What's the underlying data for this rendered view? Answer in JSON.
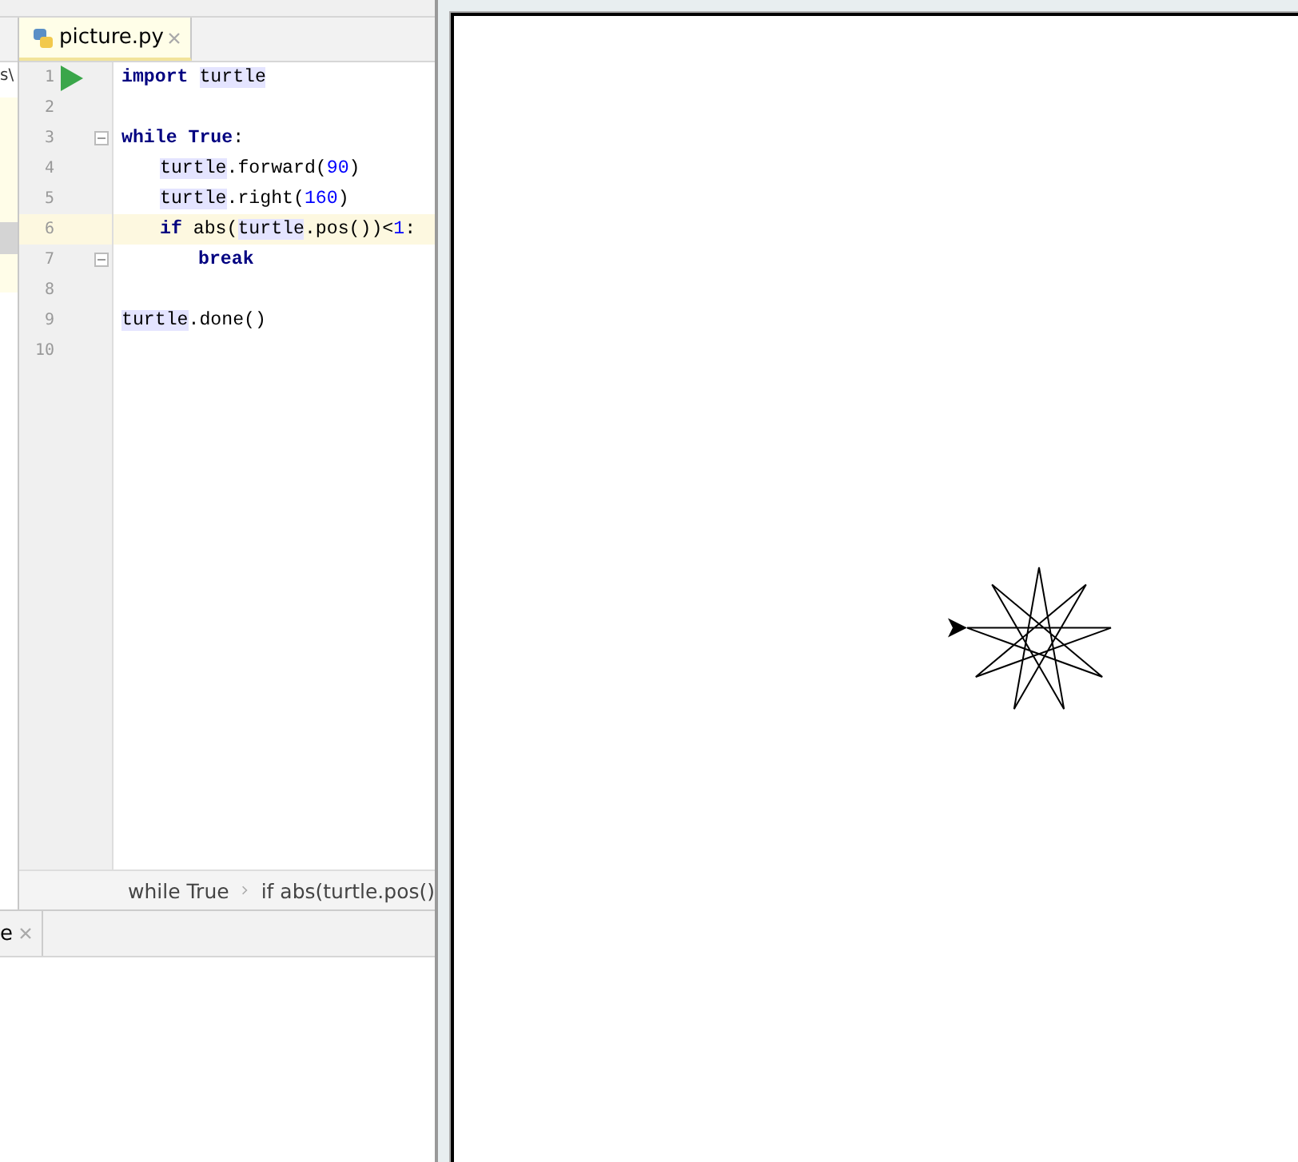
{
  "left_strip": {
    "path_fragment": "s\\"
  },
  "editor_tab": {
    "title": "picture.py",
    "selected": true
  },
  "code_lines": [
    {
      "number": "1",
      "run": true,
      "current": false,
      "fold": false,
      "tokens": [
        {
          "kind": "keyword",
          "text": "import"
        },
        {
          "kind": "module",
          "text": "turtle"
        }
      ]
    },
    {
      "number": "2",
      "run": false,
      "current": false,
      "fold": false
    },
    {
      "number": "3",
      "run": false,
      "current": false,
      "fold": true,
      "tokens": [
        {
          "kind": "keyword",
          "text": "while"
        },
        {
          "kind": "keyword",
          "text": "True"
        },
        {
          "kind": "plain",
          "text": ":"
        }
      ],
      "children": [
        {
          "number": "4",
          "run": false,
          "current": false,
          "fold": false,
          "tokens": [
            {
              "kind": "module",
              "text": "turtle"
            },
            {
              "kind": "plain",
              "text": ".forward("
            },
            {
              "kind": "number",
              "text": "90"
            },
            {
              "kind": "plain",
              "text": ")"
            }
          ]
        },
        {
          "number": "5",
          "run": false,
          "current": false,
          "fold": false,
          "tokens": [
            {
              "kind": "module",
              "text": "turtle"
            },
            {
              "kind": "plain",
              "text": ".right("
            },
            {
              "kind": "number",
              "text": "160"
            },
            {
              "kind": "plain",
              "text": ")"
            }
          ]
        },
        {
          "number": "6",
          "run": false,
          "current": true,
          "fold": false,
          "tokens": [
            {
              "kind": "keyword",
              "text": "if"
            },
            {
              "kind": "plain",
              "text": " abs("
            },
            {
              "kind": "module",
              "text": "turtle"
            },
            {
              "kind": "plain",
              "text": ".pos())<"
            },
            {
              "kind": "number",
              "text": "1"
            },
            {
              "kind": "plain",
              "text": ":"
            }
          ],
          "children": [
            {
              "number": "7",
              "run": false,
              "current": false,
              "fold": true,
              "tokens": [
                {
                  "kind": "keyword",
                  "text": "break"
                }
              ]
            }
          ]
        }
      ]
    },
    {
      "number": "8",
      "run": false,
      "current": false,
      "fold": false
    },
    {
      "number": "9",
      "run": false,
      "current": false,
      "fold": false,
      "tokens": [
        {
          "kind": "module",
          "text": "turtle"
        },
        {
          "kind": "plain",
          "text": ".done()"
        }
      ]
    },
    {
      "number": "10",
      "run": false,
      "current": false,
      "fold": false
    }
  ],
  "breadcrumbs": [
    "while True",
    "if abs(turtle.pos()"
  ],
  "bottom_tab": {
    "title": "e"
  }
}
